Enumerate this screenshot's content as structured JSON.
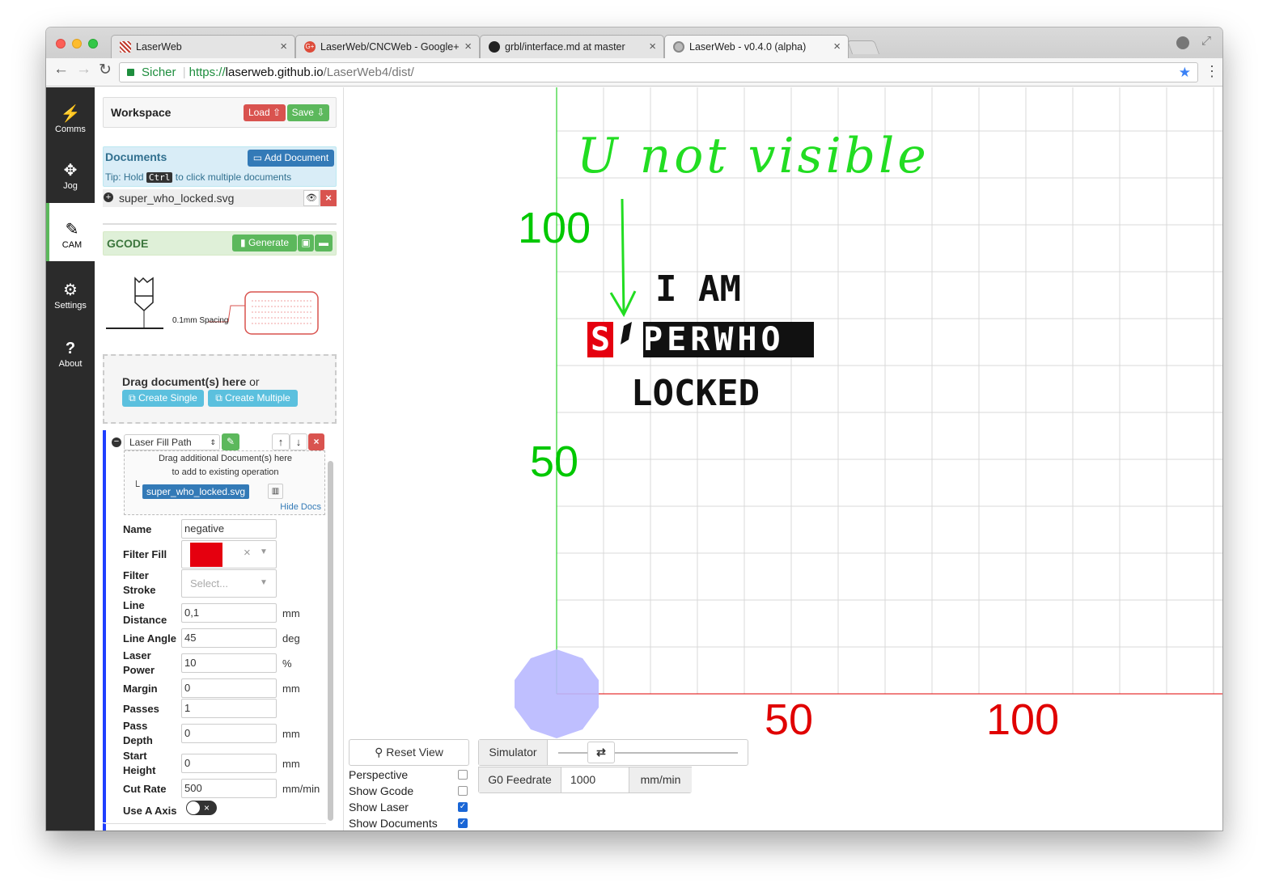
{
  "browser": {
    "tabs": [
      {
        "title": "LaserWeb"
      },
      {
        "title": "LaserWeb/CNCWeb - Google+"
      },
      {
        "title": "grbl/interface.md at master"
      },
      {
        "title": "LaserWeb - v0.4.0 (alpha)"
      }
    ],
    "secure_label": "Sicher",
    "url_scheme": "https://",
    "url_host": "laserweb.github.io",
    "url_path": "/LaserWeb4/dist/"
  },
  "sidebar": {
    "items": [
      {
        "label": "Comms",
        "icon": "plug-icon"
      },
      {
        "label": "Jog",
        "icon": "arrows-icon"
      },
      {
        "label": "CAM",
        "icon": "edit-icon",
        "active": true
      },
      {
        "label": "Settings",
        "icon": "gears-icon"
      },
      {
        "label": "About",
        "icon": "question-icon"
      }
    ]
  },
  "workspace": {
    "title": "Workspace",
    "load_label": "Load",
    "save_label": "Save"
  },
  "documents": {
    "title": "Documents",
    "add_label": "Add Document",
    "tip_prefix": "Tip: Hold",
    "tip_key": "Ctrl",
    "tip_suffix": "to click multiple documents",
    "items": [
      {
        "name": "super_who_locked.svg"
      }
    ]
  },
  "gcode": {
    "title": "GCODE",
    "generate_label": "Generate"
  },
  "diagram": {
    "spacing_label": "0.1mm Spacing"
  },
  "dropzone": {
    "text_bold": "Drag document(s) here",
    "text_tail": "or",
    "create_single": "Create Single",
    "create_multiple": "Create Multiple"
  },
  "operation": {
    "type": "Laser Fill Path",
    "drag_hint_1": "Drag additional Document(s) here",
    "drag_hint_2": "to add to existing operation",
    "doc_name": "super_who_locked.svg",
    "hide_docs": "Hide Docs",
    "filter_fill_color": "#e5000f",
    "fields": {
      "name": {
        "label": "Name",
        "value": "negative"
      },
      "filter_fill": {
        "label": "Filter Fill"
      },
      "filter_stroke": {
        "label_1": "Filter",
        "label_2": "Stroke",
        "placeholder": "Select..."
      },
      "line_distance": {
        "label_1": "Line",
        "label_2": "Distance",
        "value": "0,1",
        "unit": "mm"
      },
      "line_angle": {
        "label": "Line Angle",
        "value": "45",
        "unit": "deg"
      },
      "laser_power": {
        "label_1": "Laser",
        "label_2": "Power",
        "value": "10",
        "unit": "%"
      },
      "margin": {
        "label": "Margin",
        "value": "0",
        "unit": "mm"
      },
      "passes": {
        "label": "Passes",
        "value": "1"
      },
      "pass_depth": {
        "label_1": "Pass",
        "label_2": "Depth",
        "value": "0",
        "unit": "mm"
      },
      "start_height": {
        "label_1": "Start",
        "label_2": "Height",
        "value": "0",
        "unit": "mm"
      },
      "cut_rate": {
        "label": "Cut Rate",
        "value": "500",
        "unit": "mm/min"
      },
      "use_a_axis": {
        "label": "Use A Axis",
        "on": false
      }
    }
  },
  "canvas": {
    "annotation": "U not visible",
    "y_labels": [
      "100",
      "50"
    ],
    "x_labels": [
      "50",
      "100"
    ],
    "text_line_1": "I AM",
    "text_line_2": [
      "S",
      "P",
      "E",
      "R",
      "W",
      "H",
      "O"
    ],
    "text_line_3": "LOCKED",
    "axis_colors": {
      "x": "#e00000",
      "y": "#00c800",
      "annotation": "#22dd22",
      "grid": "#d8d8d8",
      "laser": "#b8b8ff"
    }
  },
  "controls": {
    "reset_view": "Reset View",
    "simulator": "Simulator",
    "g0_feedrate_label": "G0 Feedrate",
    "g0_feedrate_value": "1000",
    "g0_feedrate_unit": "mm/min",
    "checkboxes": [
      {
        "label": "Perspective",
        "checked": false
      },
      {
        "label": "Show Gcode",
        "checked": false
      },
      {
        "label": "Show Laser",
        "checked": true
      },
      {
        "label": "Show Documents",
        "checked": true
      }
    ]
  }
}
